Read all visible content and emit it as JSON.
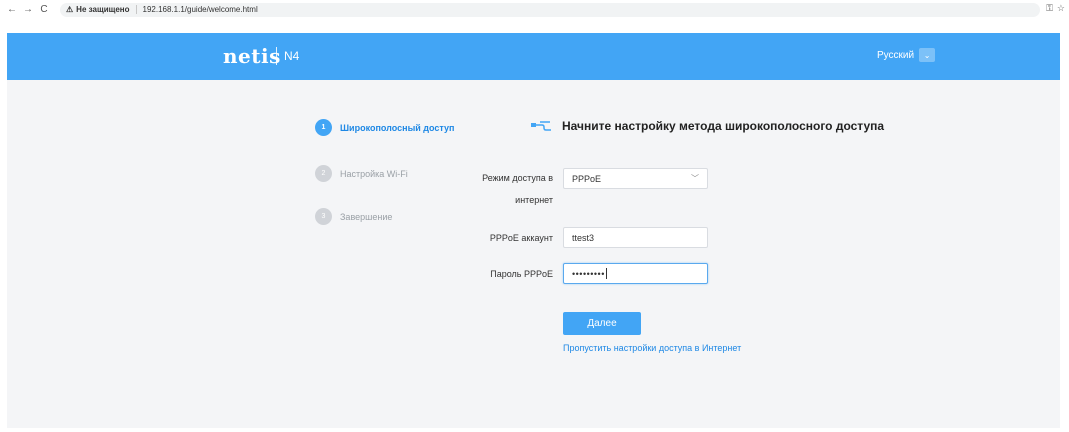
{
  "browser": {
    "back_icon": "←",
    "forward_icon": "→",
    "reload_icon": "C",
    "warning_icon": "⚠",
    "security_label": "Не защищено",
    "url": "192.168.1.1/guide/welcome.html",
    "right_icons": [
      "key-icon",
      "star-icon"
    ]
  },
  "header": {
    "logo": "netis",
    "model": "N4",
    "language": "Русский",
    "language_caret": "⌄",
    "accent_color": "#42a5f5"
  },
  "steps": [
    {
      "num": "1",
      "label": "Широкополосный доступ",
      "active": true
    },
    {
      "num": "2",
      "label": "Настройка Wi-Fi",
      "active": false
    },
    {
      "num": "3",
      "label": "Завершение",
      "active": false
    }
  ],
  "form": {
    "title": "Начните настройку метода широкополосного доступа",
    "mode_label_line1": "Режим доступа в",
    "mode_label_line2": "интернет",
    "mode_value": "PPPoE",
    "account_label": "PPPoE аккаунт",
    "account_value": "ttest3",
    "password_label": "Пароль PPPoE",
    "password_value": "•••••••••",
    "next_button": "Далее",
    "skip_link": "Пропустить настройки доступа в Интернет"
  }
}
